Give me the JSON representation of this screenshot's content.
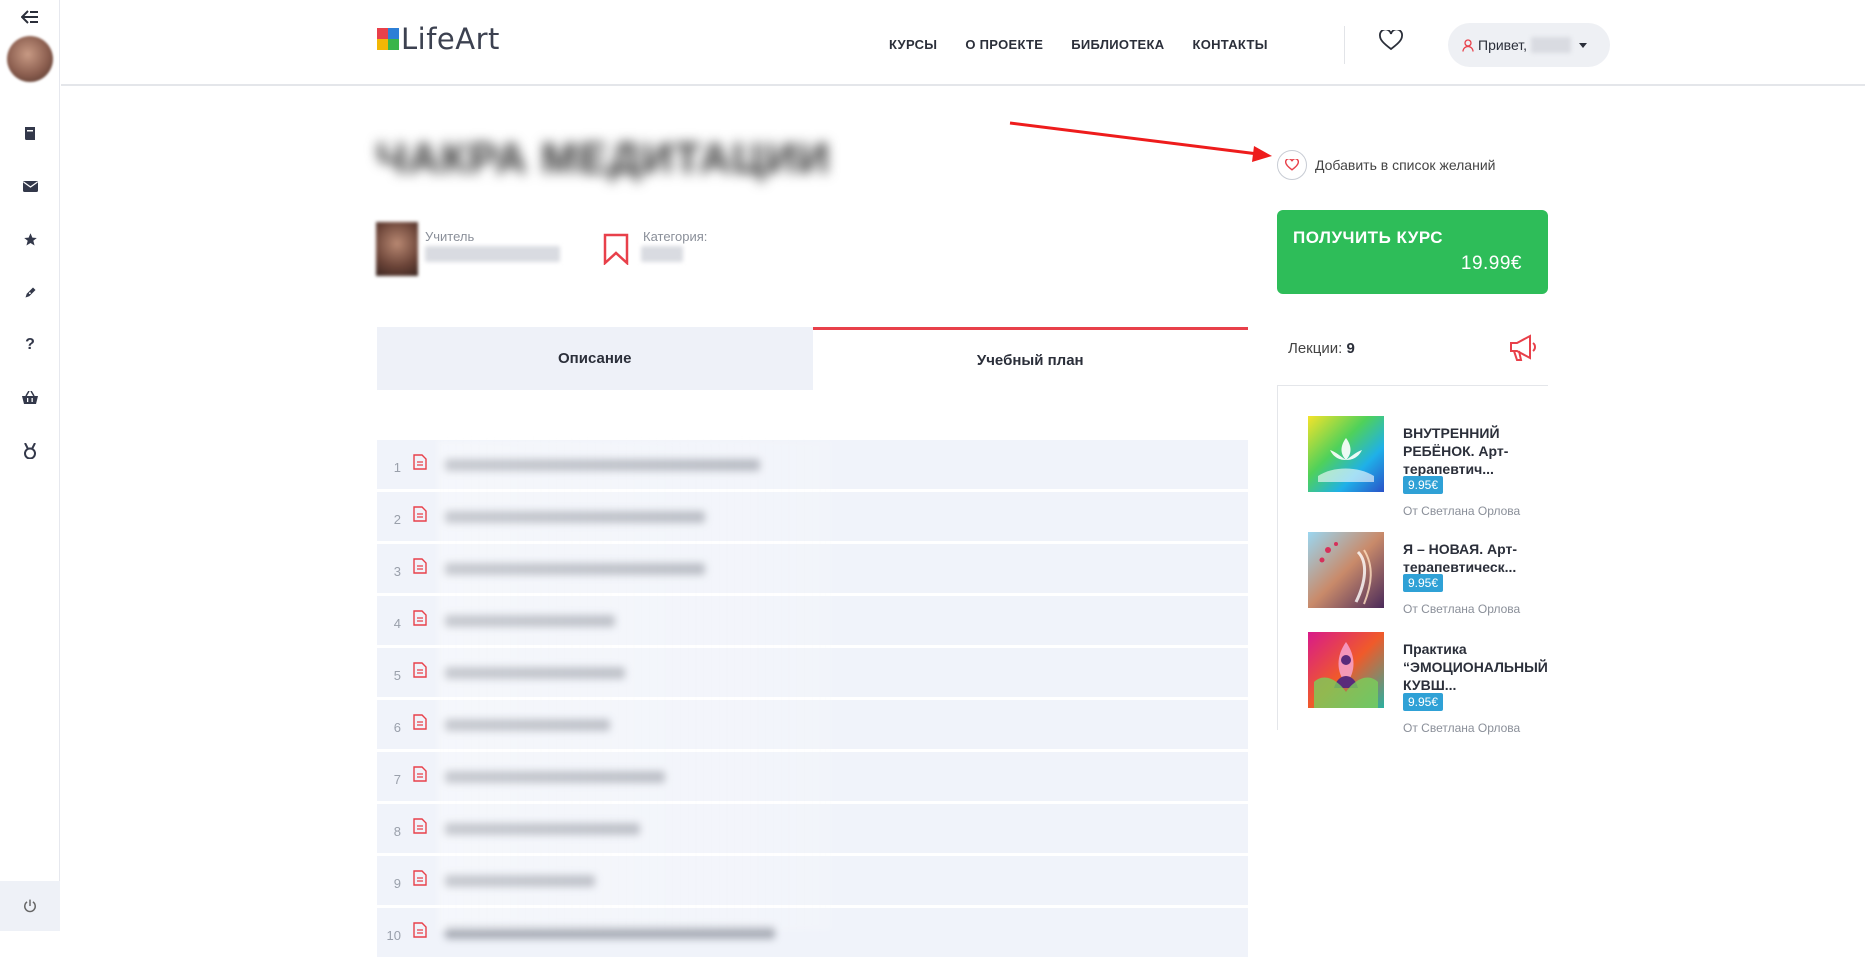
{
  "sidebar": {
    "icons": [
      "back-arrow-icon",
      "book-icon",
      "envelope-icon",
      "star-icon",
      "pen-icon",
      "question-icon",
      "basket-icon",
      "award-icon"
    ],
    "power_icon": "power-icon"
  },
  "header": {
    "logo_text": "LifeArt",
    "nav": [
      "КУРСЫ",
      "О ПРОЕКТЕ",
      "БИБЛИОТЕКА",
      "КОНТАКТЫ"
    ],
    "greeting": "Привет,"
  },
  "course": {
    "title": "ЧАКРА МЕДИТАЦИИ",
    "teacher_label": "Учитель",
    "category_label": "Категория:",
    "wishlist_label": "Добавить в список желаний",
    "buy_label": "ПОЛУЧИТЬ КУРС",
    "price": "19.99€"
  },
  "tabs": [
    {
      "label": "Описание",
      "active": false
    },
    {
      "label": "Учебный план",
      "active": true
    }
  ],
  "lessons": [
    {
      "num": "1",
      "w": 315
    },
    {
      "num": "2",
      "w": 260
    },
    {
      "num": "3",
      "w": 260
    },
    {
      "num": "4",
      "w": 170
    },
    {
      "num": "5",
      "w": 180
    },
    {
      "num": "6",
      "w": 165
    },
    {
      "num": "7",
      "w": 220
    },
    {
      "num": "8",
      "w": 195
    },
    {
      "num": "9",
      "w": 150
    },
    {
      "num": "10",
      "w": 330
    }
  ],
  "sidebar_right": {
    "lectures_label": "Лекции:",
    "lectures_count": "9",
    "related": [
      {
        "title": "ВНУТРЕННИЙ РЕБЁНОК. Арт-терапевтич...",
        "price": "9.95€",
        "author": "От Светлана Орлова"
      },
      {
        "title": "Я – НОВАЯ. Арт-терапевтическ...",
        "price": "9.95€",
        "author": "От Светлана Орлова"
      },
      {
        "title": "Практика “ЭМОЦИОНАЛЬНЫЙ КУВШ...",
        "price": "9.95€",
        "author": "От Светлана Орлова"
      }
    ]
  }
}
